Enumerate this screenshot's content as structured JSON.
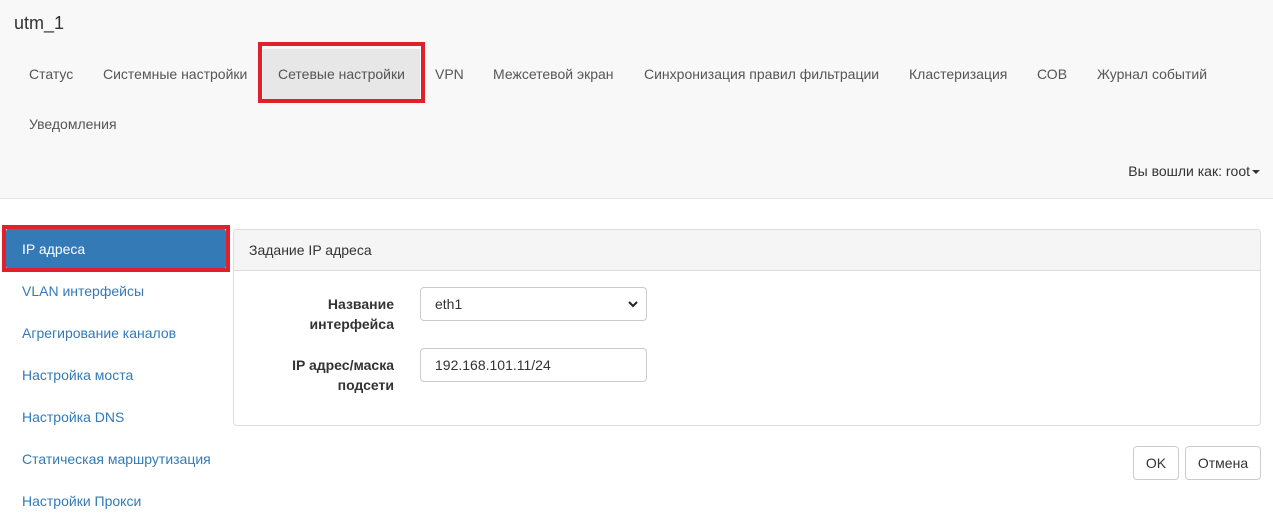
{
  "app": {
    "title": "utm_1"
  },
  "topnav": {
    "items": [
      {
        "label": "Статус"
      },
      {
        "label": "Системные настройки"
      },
      {
        "label": "Сетевые настройки"
      },
      {
        "label": "VPN"
      },
      {
        "label": "Межсетевой экран"
      },
      {
        "label": "Синхронизация правил фильтрации"
      },
      {
        "label": "Кластеризация"
      },
      {
        "label": "СОВ"
      },
      {
        "label": "Журнал событий"
      },
      {
        "label": "Уведомления"
      }
    ],
    "active": "Сетевые настройки"
  },
  "user": {
    "label": "Вы вошли как: root"
  },
  "sidebar": {
    "items": [
      {
        "label": "IP адреса"
      },
      {
        "label": "VLAN интерфейсы"
      },
      {
        "label": "Агрегирование каналов"
      },
      {
        "label": "Настройка моста"
      },
      {
        "label": "Настройка DNS"
      },
      {
        "label": "Статическая маршрутизация"
      },
      {
        "label": "Настройки Прокси"
      }
    ],
    "active": "IP адреса"
  },
  "panel": {
    "title": "Задание IP адреса",
    "fields": {
      "interface": {
        "label_line1": "Название",
        "label_line2": "интерфейса",
        "value": "eth1"
      },
      "ip": {
        "label_line1": "IP адрес/маска",
        "label_line2": "подсети",
        "value": "192.168.101.11/24"
      }
    }
  },
  "actions": {
    "ok_label": "OK",
    "cancel_label": "Отмена"
  },
  "colors": {
    "accent": "#337ab7",
    "highlight": "#e0212b"
  }
}
